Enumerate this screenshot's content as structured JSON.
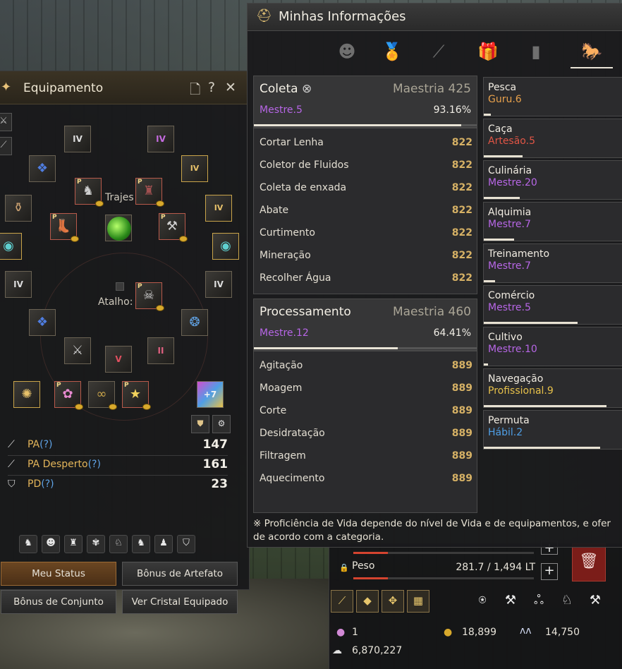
{
  "colors": {
    "mestre": "#b766e6",
    "guru": "#e8a14c",
    "artesao": "#e05545",
    "profissional": "#e6c04a",
    "habil": "#4f9fe6",
    "gold_value": "#d6b165"
  },
  "equipment": {
    "title": "Equipamento",
    "trajes_label": "Trajes",
    "atalho_label": "Atalho: U",
    "slot_marks": {
      "iv": "IV",
      "ii": "II",
      "v": "V",
      "plus7": "+7",
      "p": "P"
    },
    "stats": [
      {
        "icon": "sword-icon",
        "label": "PA",
        "help": "(?)",
        "value": "147"
      },
      {
        "icon": "awakening-sword-icon",
        "label": "PA Desperto",
        "help": "(?)",
        "value": "161"
      },
      {
        "icon": "shield-icon",
        "label": "PD",
        "help": "(?)",
        "value": "23"
      }
    ],
    "buttons": {
      "meu_status": "Meu Status",
      "bonus_artefato": "Bônus de Artefato",
      "bonus_conjunto": "Bônus de Conjunto",
      "ver_cristal": "Ver Cristal Equipado"
    }
  },
  "inventory": {
    "peso_label": "Peso",
    "peso_value": "281.7 / 1,494 LT",
    "peso_fill": 0.19,
    "slots_fill": 0.19,
    "pearls": "1",
    "coins": "18,899",
    "energy": "14,750",
    "silver": "6,870,227"
  },
  "info": {
    "title": "Minhas Informações",
    "tabs": [
      "profile-icon",
      "medal-icon",
      "telescope-icon",
      "gift-icon",
      "bar-chart-icon",
      "life-skill-icon"
    ],
    "coleta": {
      "title": "Coleta",
      "mastery": "Maestria 425",
      "rank": "Mestre.5",
      "pct": "93.16%",
      "progress": 0.9316,
      "items": [
        {
          "name": "Cortar Lenha",
          "value": "822"
        },
        {
          "name": "Coletor de Fluidos",
          "value": "822"
        },
        {
          "name": "Coleta de enxada",
          "value": "822"
        },
        {
          "name": "Abate",
          "value": "822"
        },
        {
          "name": "Curtimento",
          "value": "822"
        },
        {
          "name": "Mineração",
          "value": "822"
        },
        {
          "name": "Recolher Água",
          "value": "822"
        }
      ]
    },
    "processamento": {
      "title": "Processamento",
      "mastery": "Maestria 460",
      "rank": "Mestre.12",
      "pct": "64.41%",
      "progress": 0.6441,
      "items": [
        {
          "name": "Agitação",
          "value": "889"
        },
        {
          "name": "Moagem",
          "value": "889"
        },
        {
          "name": "Corte",
          "value": "889"
        },
        {
          "name": "Desidratação",
          "value": "889"
        },
        {
          "name": "Filtragem",
          "value": "889"
        },
        {
          "name": "Aquecimento",
          "value": "889"
        }
      ]
    },
    "life_skills": [
      {
        "name": "Pesca",
        "rank": "Guru.6",
        "color": "#e8a14c",
        "fill": 0.05
      },
      {
        "name": "Caça",
        "rank": "Artesão.5",
        "color": "#e05545",
        "fill": 0.28
      },
      {
        "name": "Culinária",
        "rank": "Mestre.20",
        "color": "#b766e6",
        "fill": 0.26
      },
      {
        "name": "Alquimia",
        "rank": "Mestre.7",
        "color": "#b766e6",
        "fill": 0.22
      },
      {
        "name": "Treinamento",
        "rank": "Mestre.7",
        "color": "#b766e6",
        "fill": 0.08
      },
      {
        "name": "Comércio",
        "rank": "Mestre.5",
        "color": "#b766e6",
        "fill": 0.68
      },
      {
        "name": "Cultivo",
        "rank": "Mestre.10",
        "color": "#b766e6",
        "fill": 0.03
      },
      {
        "name": "Navegação",
        "rank": "Profissional.9",
        "color": "#e6c04a",
        "fill": 0.89
      },
      {
        "name": "Permuta",
        "rank": "Hábil.2",
        "color": "#4f9fe6",
        "fill": 0.84
      }
    ],
    "note_line1": "※ Proficiência de Vida depende do nível de Vida e de equipamentos, e ofer",
    "note_line2": "de acordo com a categoria."
  }
}
